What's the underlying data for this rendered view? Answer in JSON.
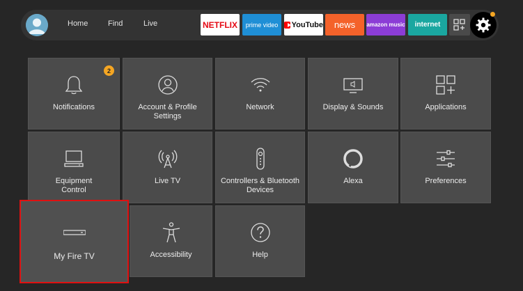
{
  "nav": {
    "home": "Home",
    "find": "Find",
    "live": "Live"
  },
  "apps": {
    "netflix": "NETFLIX",
    "prime": "prime video",
    "youtube": "YouTube",
    "news": "news",
    "music": "amazon music",
    "internet": "internet"
  },
  "colors": {
    "accent": "#f5a623",
    "selection": "#e01010",
    "tile": "#4b4b4b"
  },
  "tiles": {
    "notifications": {
      "label": "Notifications",
      "badge": "2"
    },
    "account": {
      "label": "Account & Profile Settings"
    },
    "network": {
      "label": "Network"
    },
    "display": {
      "label": "Display & Sounds"
    },
    "applications": {
      "label": "Applications"
    },
    "equipment": {
      "label": "Equipment Control"
    },
    "livetv": {
      "label": "Live TV"
    },
    "controllers": {
      "label": "Controllers & Bluetooth Devices"
    },
    "alexa": {
      "label": "Alexa"
    },
    "preferences": {
      "label": "Preferences"
    },
    "myfiretv": {
      "label": "My Fire TV"
    },
    "accessibility": {
      "label": "Accessibility"
    },
    "help": {
      "label": "Help"
    }
  }
}
